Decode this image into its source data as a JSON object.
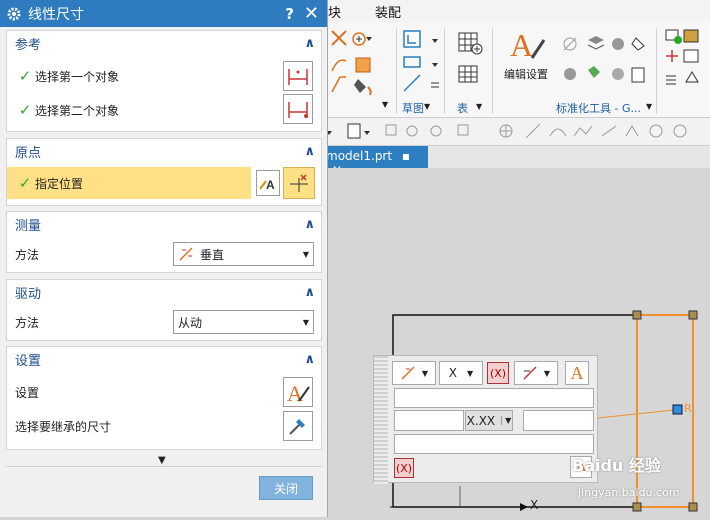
{
  "app": {
    "menus": [
      "块",
      "装配"
    ],
    "ribbon_groups": [
      "草图",
      "表",
      "标准化工具 - G...",
      ""
    ],
    "ribbon_buttons": {
      "edit_settings": "编辑设置"
    },
    "doc_tab": "model1.prt"
  },
  "dialog": {
    "title": "线性尺寸",
    "help": "?",
    "close_x": "✕",
    "sections": {
      "reference": {
        "title": "参考",
        "row1": "选择第一个对象",
        "row2": "选择第二个对象"
      },
      "origin": {
        "title": "原点",
        "row1": "指定位置"
      },
      "measure": {
        "title": "测量",
        "method_label": "方法",
        "method_value": "垂直"
      },
      "drive": {
        "title": "驱动",
        "method_label": "方法",
        "method_value": "从动"
      },
      "settings": {
        "title": "设置",
        "row1": "设置",
        "row2": "选择要继承的尺寸"
      }
    },
    "close_button": "关闭"
  },
  "float_panel": {
    "combo_x": "X",
    "tol_format": "X.XX",
    "text_A": "A"
  },
  "canvas": {
    "axis_x": "X",
    "handle_label": "R"
  },
  "watermark": {
    "text": "Baidu 经验",
    "url": "jingyan.baidu.com"
  },
  "colors": {
    "accent": "#2f7bbf",
    "highlight": "#ffe085",
    "check": "#2fa82f",
    "close_btn": "#82b2de"
  }
}
